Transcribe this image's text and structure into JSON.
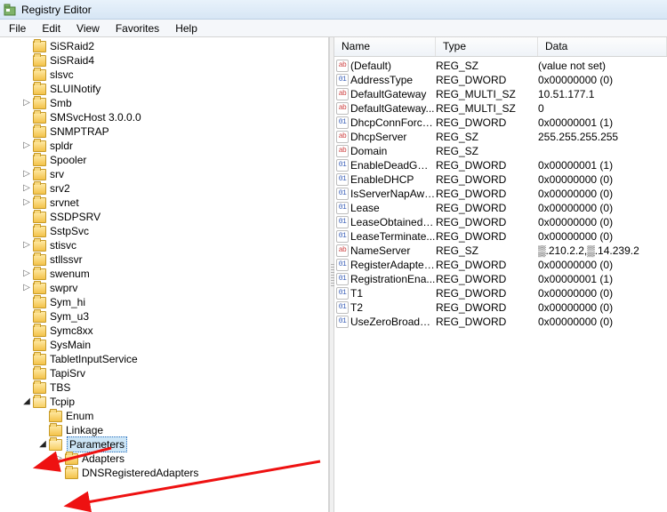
{
  "window": {
    "title": "Registry Editor"
  },
  "menubar": [
    "File",
    "Edit",
    "View",
    "Favorites",
    "Help"
  ],
  "columns": [
    "Name",
    "Type",
    "Data"
  ],
  "tree": [
    {
      "label": "SiSRaid2",
      "depth": 1,
      "toggle": ""
    },
    {
      "label": "SiSRaid4",
      "depth": 1,
      "toggle": ""
    },
    {
      "label": "slsvc",
      "depth": 1,
      "toggle": ""
    },
    {
      "label": "SLUINotify",
      "depth": 1,
      "toggle": ""
    },
    {
      "label": "Smb",
      "depth": 1,
      "toggle": "▷"
    },
    {
      "label": "SMSvcHost 3.0.0.0",
      "depth": 1,
      "toggle": ""
    },
    {
      "label": "SNMPTRAP",
      "depth": 1,
      "toggle": ""
    },
    {
      "label": "spldr",
      "depth": 1,
      "toggle": "▷"
    },
    {
      "label": "Spooler",
      "depth": 1,
      "toggle": ""
    },
    {
      "label": "srv",
      "depth": 1,
      "toggle": "▷"
    },
    {
      "label": "srv2",
      "depth": 1,
      "toggle": "▷"
    },
    {
      "label": "srvnet",
      "depth": 1,
      "toggle": "▷"
    },
    {
      "label": "SSDPSRV",
      "depth": 1,
      "toggle": ""
    },
    {
      "label": "SstpSvc",
      "depth": 1,
      "toggle": ""
    },
    {
      "label": "stisvc",
      "depth": 1,
      "toggle": "▷"
    },
    {
      "label": "stllssvr",
      "depth": 1,
      "toggle": ""
    },
    {
      "label": "swenum",
      "depth": 1,
      "toggle": "▷"
    },
    {
      "label": "swprv",
      "depth": 1,
      "toggle": "▷"
    },
    {
      "label": "Sym_hi",
      "depth": 1,
      "toggle": ""
    },
    {
      "label": "Sym_u3",
      "depth": 1,
      "toggle": ""
    },
    {
      "label": "Symc8xx",
      "depth": 1,
      "toggle": ""
    },
    {
      "label": "SysMain",
      "depth": 1,
      "toggle": ""
    },
    {
      "label": "TabletInputService",
      "depth": 1,
      "toggle": ""
    },
    {
      "label": "TapiSrv",
      "depth": 1,
      "toggle": ""
    },
    {
      "label": "TBS",
      "depth": 1,
      "toggle": ""
    },
    {
      "label": "Tcpip",
      "depth": 1,
      "toggle": "◢",
      "open": true
    },
    {
      "label": "Enum",
      "depth": 2,
      "toggle": ""
    },
    {
      "label": "Linkage",
      "depth": 2,
      "toggle": ""
    },
    {
      "label": "Parameters",
      "depth": 2,
      "toggle": "◢",
      "open": true,
      "selected": true
    },
    {
      "label": "Adapters",
      "depth": 3,
      "toggle": "▷"
    },
    {
      "label": "DNSRegisteredAdapters",
      "depth": 3,
      "toggle": ""
    }
  ],
  "values": [
    {
      "name": "(Default)",
      "type": "REG_SZ",
      "data": "(value not set)",
      "kind": "sz"
    },
    {
      "name": "AddressType",
      "type": "REG_DWORD",
      "data": "0x00000000 (0)",
      "kind": "dw"
    },
    {
      "name": "DefaultGateway",
      "type": "REG_MULTI_SZ",
      "data": "10.51.177.1",
      "kind": "sz"
    },
    {
      "name": "DefaultGateway...",
      "type": "REG_MULTI_SZ",
      "data": "0",
      "kind": "sz"
    },
    {
      "name": "DhcpConnForce...",
      "type": "REG_DWORD",
      "data": "0x00000001 (1)",
      "kind": "dw"
    },
    {
      "name": "DhcpServer",
      "type": "REG_SZ",
      "data": "255.255.255.255",
      "kind": "sz"
    },
    {
      "name": "Domain",
      "type": "REG_SZ",
      "data": "",
      "kind": "sz"
    },
    {
      "name": "EnableDeadGW...",
      "type": "REG_DWORD",
      "data": "0x00000001 (1)",
      "kind": "dw"
    },
    {
      "name": "EnableDHCP",
      "type": "REG_DWORD",
      "data": "0x00000000 (0)",
      "kind": "dw"
    },
    {
      "name": "IsServerNapAware",
      "type": "REG_DWORD",
      "data": "0x00000000 (0)",
      "kind": "dw"
    },
    {
      "name": "Lease",
      "type": "REG_DWORD",
      "data": "0x00000000 (0)",
      "kind": "dw"
    },
    {
      "name": "LeaseObtainedT...",
      "type": "REG_DWORD",
      "data": "0x00000000 (0)",
      "kind": "dw"
    },
    {
      "name": "LeaseTerminate...",
      "type": "REG_DWORD",
      "data": "0x00000000 (0)",
      "kind": "dw"
    },
    {
      "name": "NameServer",
      "type": "REG_SZ",
      "data": "▒.210.2.2,▒.14.239.2",
      "kind": "sz"
    },
    {
      "name": "RegisterAdapter...",
      "type": "REG_DWORD",
      "data": "0x00000000 (0)",
      "kind": "dw"
    },
    {
      "name": "RegistrationEna...",
      "type": "REG_DWORD",
      "data": "0x00000001 (1)",
      "kind": "dw"
    },
    {
      "name": "T1",
      "type": "REG_DWORD",
      "data": "0x00000000 (0)",
      "kind": "dw"
    },
    {
      "name": "T2",
      "type": "REG_DWORD",
      "data": "0x00000000 (0)",
      "kind": "dw"
    },
    {
      "name": "UseZeroBroadcast",
      "type": "REG_DWORD",
      "data": "0x00000000 (0)",
      "kind": "dw"
    }
  ]
}
